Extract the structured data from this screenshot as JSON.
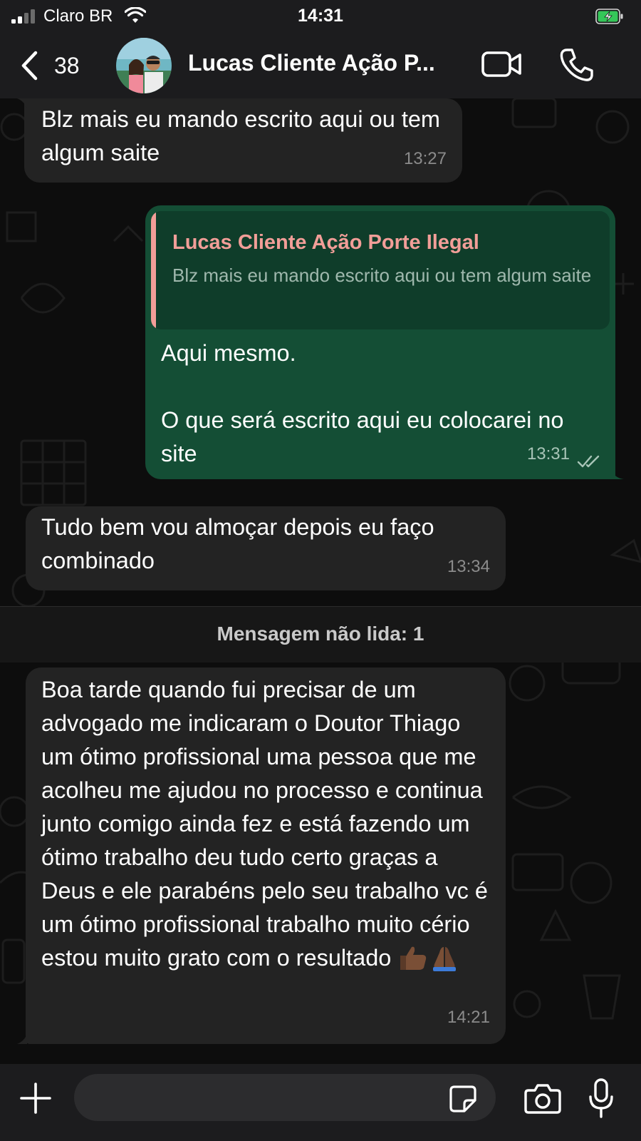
{
  "status_bar": {
    "carrier": "Claro BR",
    "time": "14:31",
    "battery_state": "charging"
  },
  "header": {
    "back_count": "38",
    "contact_name": "Lucas Cliente Ação P...",
    "icons": [
      "chevron-left-icon",
      "video-camera-icon",
      "phone-icon"
    ]
  },
  "messages": [
    {
      "direction": "incoming",
      "text": "Blz mais eu mando escrito aqui ou tem algum saite",
      "time": "13:27"
    },
    {
      "direction": "outgoing",
      "quote_author": "Lucas Cliente Ação Porte Ilegal",
      "quote_text": "Blz mais eu mando escrito aqui ou tem algum saite",
      "text": "Aqui mesmo.\n\nO que será escrito aqui eu colocarei no site",
      "time": "13:31",
      "status": "read"
    },
    {
      "direction": "incoming",
      "text": "Tudo bem vou almoçar depois eu faço combinado",
      "time": "13:34"
    },
    {
      "direction": "incoming",
      "text": "Boa tarde quando fui precisar de um advogado me indicaram o Doutor Thiago um ótimo profissional uma pessoa que me acolheu me ajudou no processo e continua junto comigo ainda fez e está fazendo um ótimo trabalho deu tudo certo graças a Deus e ele parabéns pelo seu trabalho vc é um ótimo profissional trabalho muito cério estou muito grato com o resultado",
      "emojis": [
        "thumbs-up-emoji",
        "folded-hands-emoji"
      ],
      "time": "14:21"
    }
  ],
  "unread_banner": "Mensagem não lida: 1",
  "input": {
    "placeholder": "",
    "icons": [
      "plus-icon",
      "sticker-icon",
      "camera-icon",
      "microphone-icon"
    ]
  },
  "colors": {
    "incoming_bubble": "#232323",
    "outgoing_bubble": "#144e35",
    "quote_accent": "#f29e98",
    "chrome": "#1c1c1e"
  }
}
